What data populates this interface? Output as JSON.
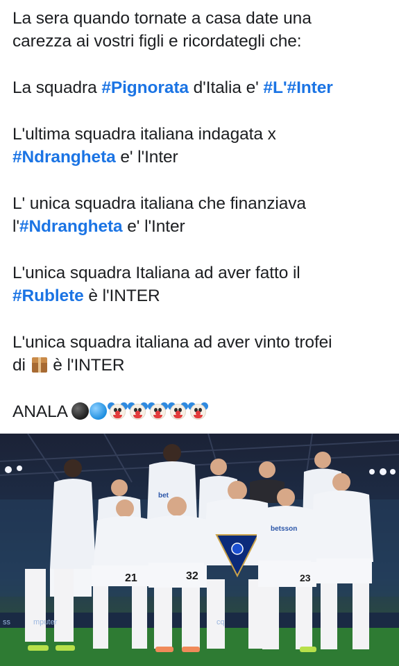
{
  "post": {
    "paragraphs": [
      {
        "lines": [
          [
            {
              "text": "La sera quando tornate a casa date una"
            }
          ],
          [
            {
              "text": "carezza ai vostri figli e ricordategli che:"
            }
          ]
        ]
      },
      {
        "lines": [
          [
            {
              "text": "La squadra "
            },
            {
              "text": "#Pignorata",
              "hashtag": true
            },
            {
              "text": " d'Italia e' "
            },
            {
              "text": "#L'#Inter",
              "hashtag": true
            }
          ]
        ]
      },
      {
        "lines": [
          [
            {
              "text": "L'ultima squadra italiana indagata x"
            }
          ],
          [
            {
              "text": "#Ndrangheta",
              "hashtag": true
            },
            {
              "text": " e' l'Inter"
            }
          ]
        ]
      },
      {
        "lines": [
          [
            {
              "text": "L' unica squadra italiana che finanziava"
            }
          ],
          [
            {
              "text": "l'"
            },
            {
              "text": "#Ndrangheta",
              "hashtag": true
            },
            {
              "text": " e' l'Inter"
            }
          ]
        ]
      },
      {
        "lines": [
          [
            {
              "text": "L'unica squadra Italiana ad aver fatto il"
            }
          ],
          [
            {
              "text": "#Rublete",
              "hashtag": true
            },
            {
              "text": " è l'INTER"
            }
          ]
        ]
      },
      {
        "lines": [
          [
            {
              "text": "L'unica squadra italiana ad aver vinto trofei"
            }
          ],
          [
            {
              "text": "di "
            },
            {
              "emoji": "package-box-icon"
            },
            {
              "text": " è l'INTER"
            }
          ]
        ]
      },
      {
        "lines": [
          [
            {
              "text": "ANALA "
            },
            {
              "emoji": "black-circle-icon"
            },
            {
              "emoji": "blue-circle-icon"
            },
            {
              "emoji": "clown-face-icon"
            },
            {
              "emoji": "clown-face-icon"
            },
            {
              "emoji": "clown-face-icon"
            },
            {
              "emoji": "clown-face-icon"
            },
            {
              "emoji": "clown-face-icon"
            }
          ]
        ]
      }
    ]
  },
  "photo": {
    "subject": "team-photo",
    "shirt_numbers": [
      "21",
      "32",
      "23"
    ],
    "sponsor_texts": [
      "betsson",
      "bet",
      "mputer",
      "cq",
      "ss"
    ]
  },
  "colors": {
    "hashtag": "#1b74e4",
    "text": "#1c1e21",
    "background": "#ffffff"
  }
}
